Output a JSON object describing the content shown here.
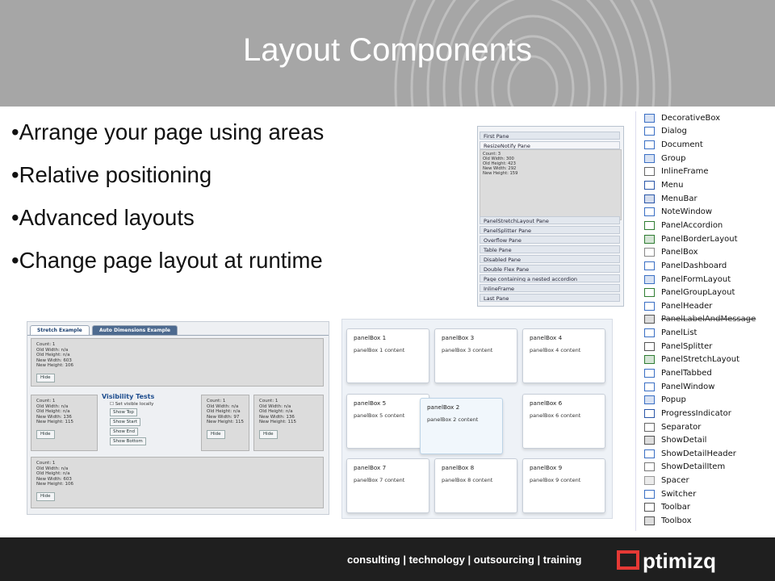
{
  "slide": {
    "title": "Layout Components",
    "bullets": [
      "Arrange your page using areas",
      "Relative positioning",
      "Advanced layouts",
      "Change page layout at runtime"
    ]
  },
  "footer": {
    "tagline": "consulting | technology | outsourcing | training",
    "logo_text": "optimizq"
  },
  "accordion": {
    "panes": [
      "First Pane",
      "ResizeNotify Pane",
      "PanelStretchLayout Pane",
      "PanelSplitter Pane",
      "Overflow Pane",
      "Table Pane",
      "Disabled Pane",
      "Double Flex Pane",
      "Page containing a nested accordion",
      "InlineFrame",
      "Last Pane"
    ],
    "resize_text": "Count: 3\nOld Width: 300\nOld Height: 423\nNew Width: 292\nNew Height: 159"
  },
  "components": [
    {
      "label": "DecorativeBox",
      "icon": "decorativebox-icon",
      "color": "#3a6fc4"
    },
    {
      "label": "Dialog",
      "icon": "dialog-icon",
      "color": "#3a6fc4"
    },
    {
      "label": "Document",
      "icon": "document-icon",
      "color": "#3a6fc4"
    },
    {
      "label": "Group",
      "icon": "group-icon",
      "color": "#3a6fc4"
    },
    {
      "label": "InlineFrame",
      "icon": "inlineframe-icon",
      "color": "#666666"
    },
    {
      "label": "Menu",
      "icon": "menu-icon",
      "color": "#2a56a8"
    },
    {
      "label": "MenuBar",
      "icon": "menubar-icon",
      "color": "#2a56a8"
    },
    {
      "label": "NoteWindow",
      "icon": "notewindow-icon",
      "color": "#3a6fc4"
    },
    {
      "label": "PanelAccordion",
      "icon": "panelaccordion-icon",
      "color": "#2f7d32"
    },
    {
      "label": "PanelBorderLayout",
      "icon": "panelborderlayout-icon",
      "color": "#2f7d32"
    },
    {
      "label": "PanelBox",
      "icon": "panelbox-icon",
      "color": "#888888"
    },
    {
      "label": "PanelDashboard",
      "icon": "paneldashboard-icon",
      "color": "#3a6fc4"
    },
    {
      "label": "PanelFormLayout",
      "icon": "panelformlayout-icon",
      "color": "#3a6fc4"
    },
    {
      "label": "PanelGroupLayout",
      "icon": "panelgrouplayout-icon",
      "color": "#2f7d32"
    },
    {
      "label": "PanelHeader",
      "icon": "panelheader-icon",
      "color": "#3a6fc4"
    },
    {
      "label": "PanelLabelAndMessage",
      "icon": "panellabelandmessage-icon",
      "color": "#555555"
    },
    {
      "label": "PanelList",
      "icon": "panellist-icon",
      "color": "#3a6fc4"
    },
    {
      "label": "PanelSplitter",
      "icon": "panelsplitter-icon",
      "color": "#555555"
    },
    {
      "label": "PanelStretchLayout",
      "icon": "panelstretchlayout-icon",
      "color": "#2f7d32"
    },
    {
      "label": "PanelTabbed",
      "icon": "paneltabbed-icon",
      "color": "#3a6fc4"
    },
    {
      "label": "PanelWindow",
      "icon": "panelwindow-icon",
      "color": "#3a6fc4"
    },
    {
      "label": "Popup",
      "icon": "popup-icon",
      "color": "#3a6fc4"
    },
    {
      "label": "ProgressIndicator",
      "icon": "progressindicator-icon",
      "color": "#2a56a8"
    },
    {
      "label": "Separator",
      "icon": "separator-icon",
      "color": "#666666"
    },
    {
      "label": "ShowDetail",
      "icon": "showdetail-icon",
      "color": "#555555"
    },
    {
      "label": "ShowDetailHeader",
      "icon": "showdetailheader-icon",
      "color": "#3a6fc4"
    },
    {
      "label": "ShowDetailItem",
      "icon": "showdetailitem-icon",
      "color": "#777777"
    },
    {
      "label": "Spacer",
      "icon": "spacer-icon",
      "color": "#999999"
    },
    {
      "label": "Switcher",
      "icon": "switcher-icon",
      "color": "#3a6fc4"
    },
    {
      "label": "Toolbar",
      "icon": "toolbar-icon",
      "color": "#555555"
    },
    {
      "label": "Toolbox",
      "icon": "toolbox-icon",
      "color": "#555555"
    }
  ],
  "stretch": {
    "tabs": [
      "Stretch Example",
      "Auto Dimensions Example"
    ],
    "top_text": "Count: 1\nOld Width: n/a\nOld Height: n/a\nNew Width: 603\nNew Height: 106",
    "left_text": "Count: 1\nOld Width: n/a\nOld Height: n/a\nNew Width: 136\nNew Height: 115",
    "mid_text": "Count: 1\nOld Width: n/a\nOld Height: n/a\nNew Width: 97\nNew Height: 115",
    "right_text": "Count: 1\nOld Width: n/a\nOld Height: n/a\nNew Width: 136\nNew Height: 115",
    "bottom_text": "Count: 1\nOld Width: n/a\nOld Height: n/a\nNew Width: 603\nNew Height: 106",
    "hide": "Hide",
    "vis_title": "Visibility Tests",
    "vis_checkbox": "Set visible locally",
    "vis_buttons": [
      "Show Top",
      "Show Start",
      "Show End",
      "Show Bottom"
    ]
  },
  "panelboxes": [
    {
      "title": "panelBox 1",
      "content": "panelBox 1 content"
    },
    {
      "title": "panelBox 3",
      "content": "panelBox 3 content"
    },
    {
      "title": "panelBox 4",
      "content": "panelBox 4 content"
    },
    {
      "title": "panelBox 5",
      "content": "panelBox 5 content"
    },
    {
      "title": "panelBox 2",
      "content": "panelBox 2 content"
    },
    {
      "title": "panelBox 6",
      "content": "panelBox 6 content"
    },
    {
      "title": "panelBox 7",
      "content": "panelBox 7 content"
    },
    {
      "title": "panelBox 8",
      "content": "panelBox 8 content"
    },
    {
      "title": "panelBox 9",
      "content": "panelBox 9 content"
    }
  ]
}
